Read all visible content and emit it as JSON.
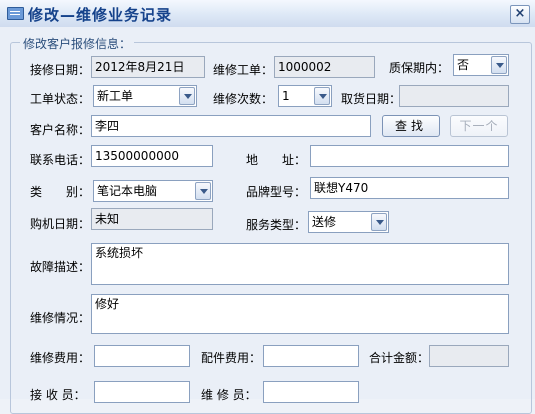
{
  "window": {
    "title": "修改—维修业务记录",
    "close": "×"
  },
  "group": {
    "legend": "修改客户报修信息："
  },
  "form": {
    "repair_date": {
      "label": "接修日期：",
      "value": "2012年8月21日"
    },
    "order_no": {
      "label": "维修工单：",
      "value": "1000002"
    },
    "warranty": {
      "label": "质保期内：",
      "value": "否"
    },
    "status": {
      "label": "工单状态：",
      "value": "新工单"
    },
    "repair_count": {
      "label": "维修次数：",
      "value": "1"
    },
    "pickup_date": {
      "label": "取货日期：",
      "value": ""
    },
    "customer": {
      "label": "客户名称：",
      "value": "李四"
    },
    "phone": {
      "label": "联系电话：",
      "value": "13500000000"
    },
    "address": {
      "label": "地　　址：",
      "value": ""
    },
    "category": {
      "label": "类　　别：",
      "value": "笔记本电脑"
    },
    "model": {
      "label": "品牌型号：",
      "value": "联想Y470"
    },
    "purchase_date": {
      "label": "购机日期：",
      "value": "未知"
    },
    "service_type": {
      "label": "服务类型：",
      "value": "送修"
    },
    "fault": {
      "label": "故障描述：",
      "value": "系统损坏"
    },
    "repair_status": {
      "label": "维修情况：",
      "value": "修好"
    },
    "repair_fee": {
      "label": "维修费用：",
      "value": ""
    },
    "parts_fee": {
      "label": "配件费用：",
      "value": ""
    },
    "total": {
      "label": "合计金额：",
      "value": ""
    },
    "receiver": {
      "label": "接 收 员：",
      "value": ""
    },
    "technician": {
      "label": "维 修 员：",
      "value": ""
    }
  },
  "buttons": {
    "search": "查找",
    "next": "下一个"
  }
}
